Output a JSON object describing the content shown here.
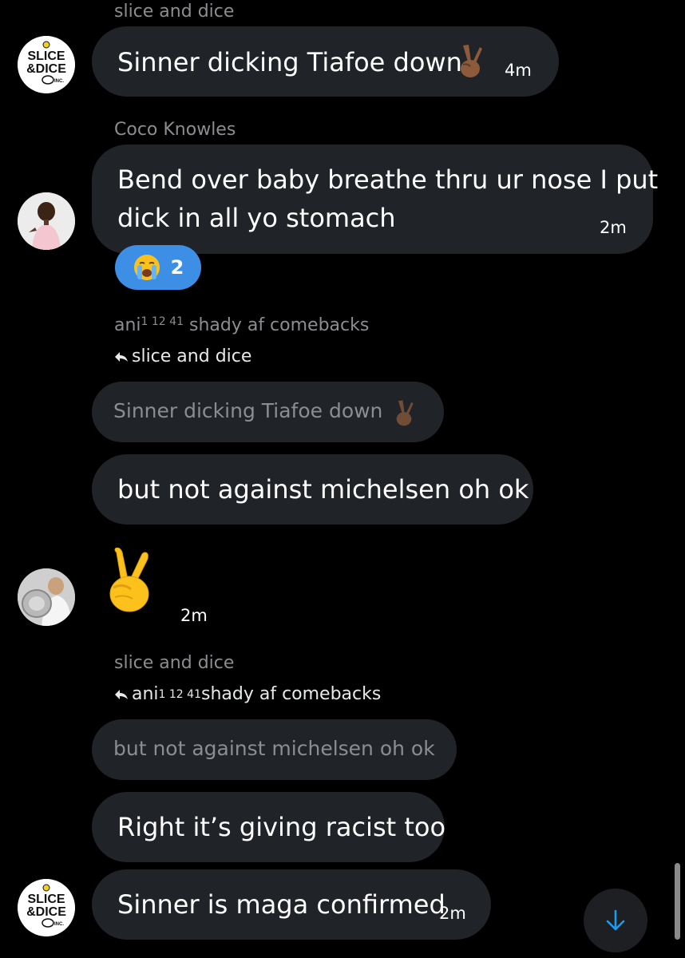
{
  "messages": [
    {
      "sender": "slice and dice",
      "text": "Sinner dicking Tiafoe down",
      "emoji": "victory-hand-medium-dark",
      "time": "4m"
    },
    {
      "sender": "Coco Knowles",
      "text_line1": "Bend over baby breathe thru ur nose I put",
      "text_line2": "dick in all yo stomach",
      "time": "2m",
      "reaction": {
        "emoji": "loudly-crying-face",
        "count": "2"
      }
    },
    {
      "sender_name": "ani",
      "sender_sup": "1 12 41",
      "sender_rest": " shady af comebacks",
      "reply_to": "slice and dice",
      "quoted": "Sinner dicking Tiafoe down",
      "text": "but not against michelsen oh ok"
    },
    {
      "emoji": "victory-hand",
      "time": "2m"
    },
    {
      "sender": "slice and dice",
      "reply_to_name": "ani",
      "reply_to_sup": "1 12 41",
      "reply_to_rest": " shady af comebacks",
      "quoted": "but not against michelsen oh ok",
      "text1": "Right it’s giving racist too",
      "text2": "Sinner is maga confirmed",
      "time": "2m"
    }
  ],
  "avatars": {
    "slice_logo_line1": "SLICE",
    "slice_logo_line2": "&DICE",
    "slice_logo_line3": "INC."
  },
  "colors": {
    "background": "#000000",
    "bubble": "#202327",
    "reaction": "#3d8fe6",
    "muted_text": "#8b8d91",
    "scroll_arrow": "#1d9bf0"
  }
}
